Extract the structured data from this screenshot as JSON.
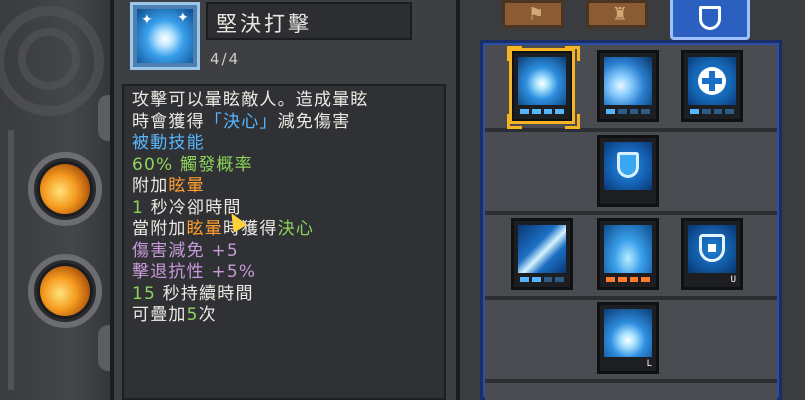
{
  "tooltip": {
    "title": "堅決打擊",
    "level": "4/4",
    "lines": [
      [
        {
          "t": "攻擊可以暈眩敵人。造成暈眩",
          "c": "white"
        }
      ],
      [
        {
          "t": "時會獲得",
          "c": "white"
        },
        {
          "t": "「決心」",
          "c": "blue"
        },
        {
          "t": "減免傷害",
          "c": "white"
        }
      ],
      [
        {
          "t": "被動技能",
          "c": "blue"
        }
      ],
      [
        {
          "t": "60% 觸發概率",
          "c": "green"
        }
      ],
      [
        {
          "t": "附加",
          "c": "white"
        },
        {
          "t": "眩暈",
          "c": "orange"
        }
      ],
      [
        {
          "t": "1",
          "c": "green"
        },
        {
          "t": " 秒冷卻時間",
          "c": "white"
        }
      ],
      [
        {
          "t": "當附加",
          "c": "white"
        },
        {
          "t": "眩暈",
          "c": "orange"
        },
        {
          "t": "時獲得",
          "c": "white"
        },
        {
          "t": "決心",
          "c": "green"
        }
      ],
      [
        {
          "t": "傷害減免 +5",
          "c": "purple"
        }
      ],
      [
        {
          "t": "擊退抗性 +5%",
          "c": "purple"
        }
      ],
      [
        {
          "t": "15",
          "c": "green"
        },
        {
          "t": " 秒持續時間",
          "c": "white"
        }
      ],
      [
        {
          "t": "可疊加",
          "c": "white"
        },
        {
          "t": "5",
          "c": "green"
        },
        {
          "t": "次",
          "c": "white"
        }
      ]
    ]
  },
  "tabs": [
    {
      "name": "tab-skills-1",
      "icon": "banner-icon",
      "active": false
    },
    {
      "name": "tab-skills-2",
      "icon": "helmet-icon",
      "active": false
    },
    {
      "name": "tab-defense",
      "icon": "shield-icon",
      "active": true
    }
  ],
  "nodes": [
    {
      "id": "resolute-strike",
      "icon": "starburst-icon",
      "art": "burst",
      "pips": [
        "on",
        "on",
        "on",
        "on"
      ],
      "selected": true,
      "badge": ""
    },
    {
      "id": "shield-bash",
      "icon": "rock-impact-icon",
      "art": "rock",
      "pips": [
        "on",
        "off",
        "off",
        "off"
      ],
      "selected": false,
      "badge": ""
    },
    {
      "id": "heal",
      "icon": "plus-icon",
      "art": "plus",
      "pips": [
        "on",
        "off",
        "off",
        "off"
      ],
      "selected": false,
      "badge": ""
    },
    {
      "id": "guard",
      "icon": "shield-icon",
      "art": "shield",
      "pips": [],
      "selected": false,
      "badge": ""
    },
    {
      "id": "slash",
      "icon": "slash-icon",
      "art": "slash",
      "pips": [
        "on",
        "on",
        "off",
        "off"
      ],
      "selected": false,
      "badge": ""
    },
    {
      "id": "pillar",
      "icon": "pillar-icon",
      "art": "pillar",
      "pips": [
        "orange",
        "orange",
        "orange",
        "orange"
      ],
      "selected": false,
      "badge": ""
    },
    {
      "id": "fortify",
      "icon": "house-shield-icon",
      "art": "house",
      "pips": [],
      "selected": false,
      "badge": "U"
    },
    {
      "id": "ground-smash",
      "icon": "smash-icon",
      "art": "smash",
      "pips": [],
      "selected": false,
      "badge": "L"
    }
  ],
  "colors": {
    "white": "#ece9e2",
    "blue": "#58b6ff",
    "green": "#8fd45a",
    "orange": "#ff9e2e",
    "purple": "#c89ad8",
    "selected": "#f6b322",
    "tree_frame": "#2a4fa8"
  }
}
